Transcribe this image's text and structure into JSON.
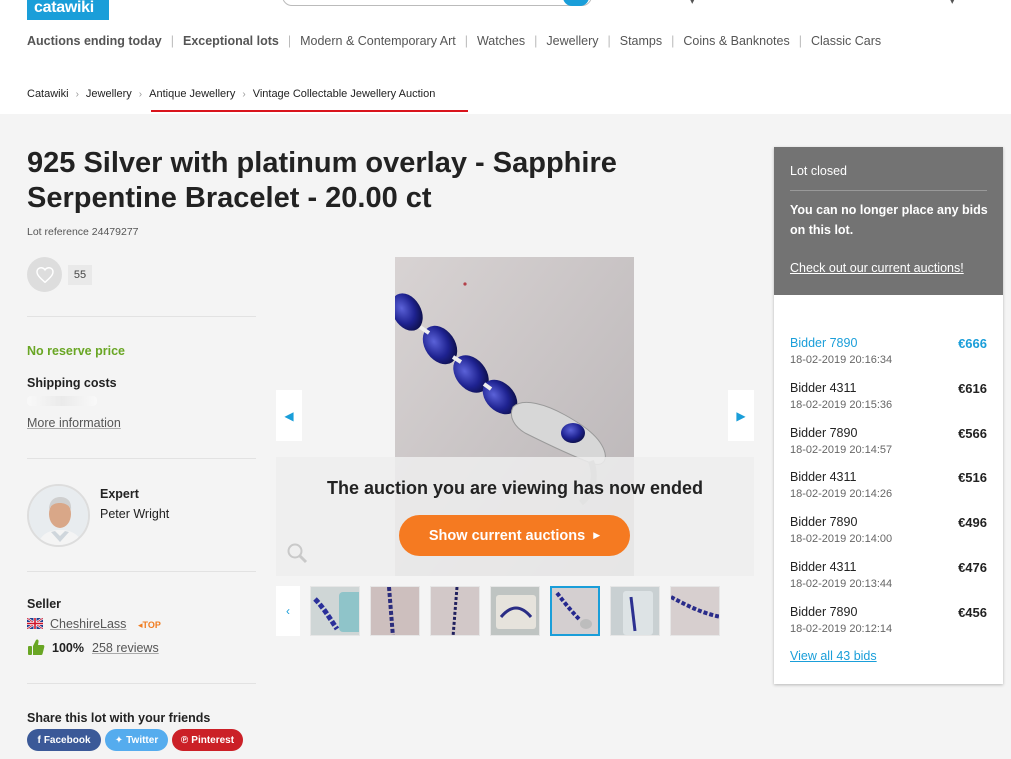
{
  "header": {
    "logo": "catawiki",
    "nav": [
      {
        "label": "Auctions ending today",
        "bold": true
      },
      {
        "label": "Exceptional lots",
        "bold": true
      },
      {
        "label": "Modern & Contemporary Art",
        "bold": false
      },
      {
        "label": "Watches",
        "bold": false
      },
      {
        "label": "Jewellery",
        "bold": false
      },
      {
        "label": "Stamps",
        "bold": false
      },
      {
        "label": "Coins & Banknotes",
        "bold": false
      },
      {
        "label": "Classic Cars",
        "bold": false
      }
    ]
  },
  "breadcrumb": [
    "Catawiki",
    "Jewellery",
    "Antique Jewellery",
    "Vintage Collectable Jewellery Auction"
  ],
  "lot": {
    "title": "925 Silver with platinum overlay - Sapphire Serpentine Bracelet - 20.00 ct",
    "reference": "Lot reference 24479277",
    "favourites": "55",
    "no_reserve": "No reserve price",
    "shipping_label": "Shipping costs",
    "more_info": "More information"
  },
  "expert": {
    "label": "Expert",
    "name": "Peter Wright"
  },
  "seller": {
    "label": "Seller",
    "name": "CheshireLass",
    "badge": "TOP",
    "rating": "100%",
    "reviews": "258 reviews"
  },
  "share": {
    "label": "Share this lot with your friends",
    "buttons": [
      "Facebook",
      "Twitter",
      "Pinterest"
    ]
  },
  "gallery": {
    "ended_message": "The auction you are viewing has now ended",
    "cta": "Show current auctions",
    "thumbnail_count": 7,
    "selected_thumbnail": 5
  },
  "panel": {
    "status": "Lot closed",
    "message": "You can no longer place any bids on this lot.",
    "link": "Check out our current auctions!",
    "bids": [
      {
        "bidder": "Bidder 7890",
        "time": "18-02-2019 20:16:34",
        "amount": "€666"
      },
      {
        "bidder": "Bidder 4311",
        "time": "18-02-2019 20:15:36",
        "amount": "€616"
      },
      {
        "bidder": "Bidder 7890",
        "time": "18-02-2019 20:14:57",
        "amount": "€566"
      },
      {
        "bidder": "Bidder 4311",
        "time": "18-02-2019 20:14:26",
        "amount": "€516"
      },
      {
        "bidder": "Bidder 7890",
        "time": "18-02-2019 20:14:00",
        "amount": "€496"
      },
      {
        "bidder": "Bidder 4311",
        "time": "18-02-2019 20:13:44",
        "amount": "€476"
      },
      {
        "bidder": "Bidder 7890",
        "time": "18-02-2019 20:12:14",
        "amount": "€456"
      }
    ],
    "view_all": "View all 43 bids"
  },
  "colors": {
    "brand_blue": "#1a9ed9",
    "cta_orange": "#f57a21",
    "reserve_green": "#69a624",
    "breadcrumb_underline": "#d9141c",
    "closed_panel": "#737373"
  }
}
